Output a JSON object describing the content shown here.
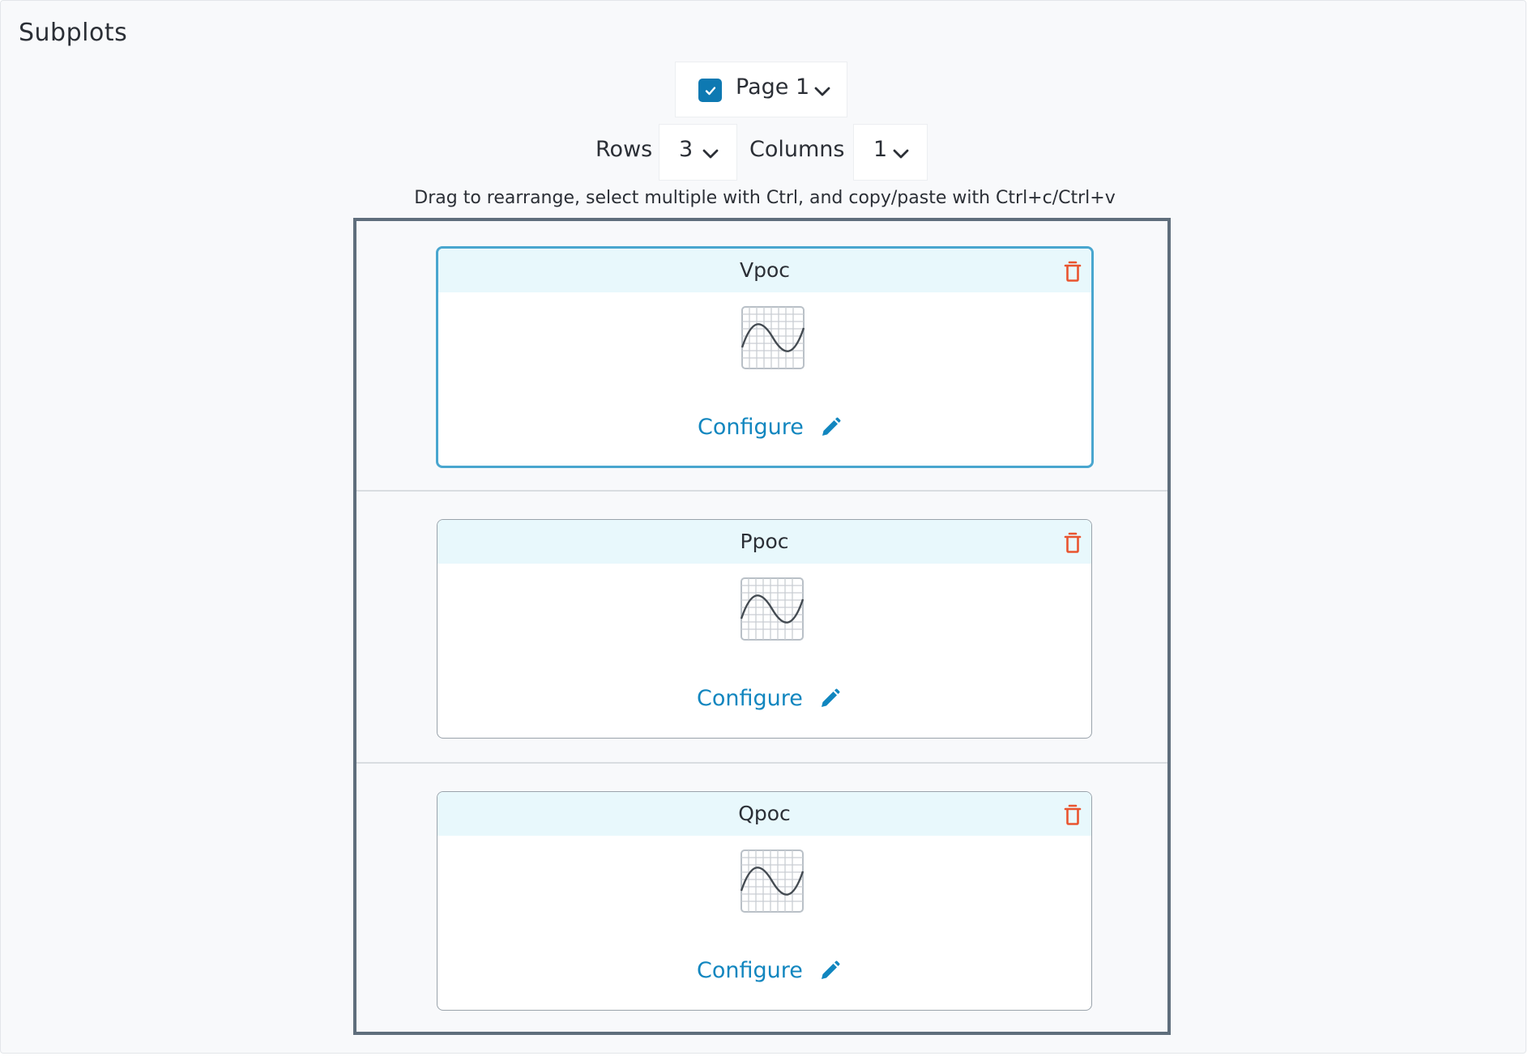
{
  "header": {
    "title": "Subplots"
  },
  "page_select": {
    "checked": true,
    "label": "Page 1"
  },
  "layout": {
    "rows_label": "Rows",
    "rows_value": "3",
    "columns_label": "Columns",
    "columns_value": "1"
  },
  "hint": "Drag to rearrange, select multiple with Ctrl, and copy/paste with Ctrl+c/Ctrl+v",
  "subplots": [
    {
      "title": "Vpoc",
      "configure_label": "Configure",
      "selected": true
    },
    {
      "title": "Ppoc",
      "configure_label": "Configure",
      "selected": false
    },
    {
      "title": "Qpoc",
      "configure_label": "Configure",
      "selected": false
    }
  ],
  "colors": {
    "accent": "#0e79b2",
    "link": "#1186bf",
    "delete": "#e9542f",
    "card_header": "#e8f8fc",
    "grid_border": "#5f6e7c",
    "selected_border": "#49a6cf"
  },
  "icons": {
    "checkbox": "check-icon",
    "dropdown": "chevron-down-icon",
    "delete": "trash-icon",
    "plot": "line-chart-icon",
    "edit": "pencil-icon"
  }
}
